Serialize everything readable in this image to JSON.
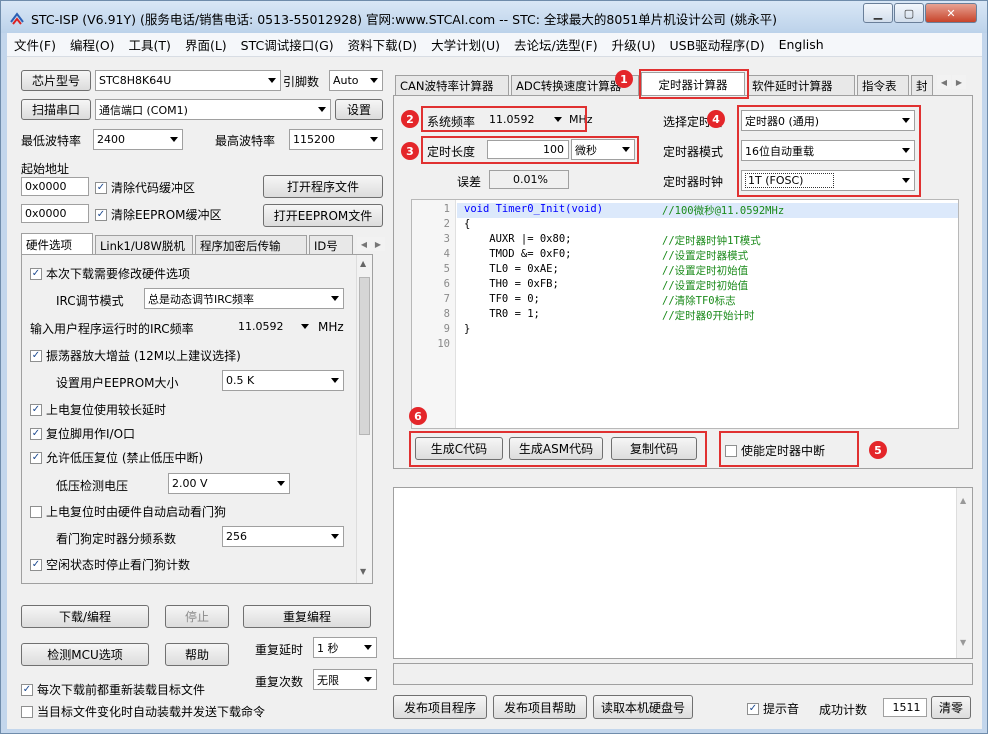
{
  "window": {
    "title": "STC-ISP (V6.91Y) (服务电话/销售电话: 0513-55012928) 官网:www.STCAI.com  -- STC: 全球最大的8051单片机设计公司 (姚永平)"
  },
  "menu": [
    "文件(F)",
    "编程(O)",
    "工具(T)",
    "界面(L)",
    "STC调试接口(G)",
    "资料下载(D)",
    "大学计划(U)",
    "去论坛/选型(F)",
    "升级(U)",
    "USB驱动程序(D)",
    "English"
  ],
  "left": {
    "chip_label": "芯片型号",
    "chip_value": "STC8H8K64U",
    "pin_label": "引脚数",
    "pin_value": "Auto",
    "scan_label": "扫描串口",
    "port_value": "通信端口 (COM1)",
    "settings_label": "设置",
    "min_baud_label": "最低波特率",
    "min_baud_value": "2400",
    "max_baud_label": "最高波特率",
    "max_baud_value": "115200",
    "start_addr_label": "起始地址",
    "addr1": "0x0000",
    "clear_code_label": "清除代码缓冲区",
    "open_prog_label": "打开程序文件",
    "addr2": "0x0000",
    "clear_eeprom_label": "清除EEPROM缓冲区",
    "open_eeprom_label": "打开EEPROM文件",
    "tabs": [
      "硬件选项",
      "Link1/U8W脱机",
      "程序加密后传输",
      "ID号"
    ],
    "options": {
      "modify_hw": "本次下载需要修改硬件选项",
      "irc_mode_label": "IRC调节模式",
      "irc_mode_value": "总是动态调节IRC频率",
      "irc_freq_label": "输入用户程序运行时的IRC频率",
      "irc_freq_value": "11.0592",
      "irc_freq_unit": "MHz",
      "osc_gain": "振荡器放大增益 (12M以上建议选择)",
      "eeprom_size_label": "设置用户EEPROM大小",
      "eeprom_size_value": "0.5 K",
      "power_delay": "上电复位使用较长延时",
      "reset_io": "复位脚用作I/O口",
      "lvr": "允许低压复位 (禁止低压中断)",
      "lv_label": "低压检测电压",
      "lv_value": "2.00 V",
      "wdt_auto": "上电复位时由硬件自动启动看门狗",
      "wdt_div_label": "看门狗定时器分频系数",
      "wdt_div_value": "256",
      "wdt_idle": "空闲状态时停止看门狗计数"
    },
    "download_label": "下载/编程",
    "stop_label": "停止",
    "reprogram_label": "重复编程",
    "detect_label": "检测MCU选项",
    "help_label": "帮助",
    "repeat_delay_label": "重复延时",
    "repeat_delay_value": "1 秒",
    "repeat_count_label": "重复次数",
    "repeat_count_value": "无限",
    "reload_before": "每次下载前都重新装载目标文件",
    "auto_reload": "当目标文件变化时自动装载并发送下载命令"
  },
  "right": {
    "tabs": [
      "CAN波特率计算器",
      "ADC转换速度计算器",
      "定时器计算器",
      "软件延时计算器",
      "指令表",
      "封"
    ],
    "sys_freq_label": "系统频率",
    "sys_freq_value": "11.0592",
    "sys_freq_unit": "MHz",
    "timer_len_label": "定时长度",
    "timer_len_value": "100",
    "timer_unit": "微秒",
    "error_label": "误差",
    "error_value": "0.01%",
    "select_timer_label": "选择定时器",
    "select_timer_value": "定时器0 (通用)",
    "timer_mode_label": "定时器模式",
    "timer_mode_value": "16位自动重载",
    "timer_clock_label": "定时器时钟",
    "timer_clock_value": "1T  (FOSC)",
    "code_lines": [
      {
        "n": "1",
        "text": "void Timer0_Init(void)",
        "comment": "//100微秒@11.0592MHz"
      },
      {
        "n": "2",
        "text": "{",
        "comment": ""
      },
      {
        "n": "3",
        "text": "    AUXR |= 0x80;",
        "comment": "//定时器时钟1T模式"
      },
      {
        "n": "4",
        "text": "    TMOD &= 0xF0;",
        "comment": "//设置定时器模式"
      },
      {
        "n": "5",
        "text": "    TL0 = 0xAE;",
        "comment": "//设置定时初始值"
      },
      {
        "n": "6",
        "text": "    TH0 = 0xFB;",
        "comment": "//设置定时初始值"
      },
      {
        "n": "7",
        "text": "    TF0 = 0;",
        "comment": "//清除TF0标志"
      },
      {
        "n": "8",
        "text": "    TR0 = 1;",
        "comment": "//定时器0开始计时"
      },
      {
        "n": "9",
        "text": "}",
        "comment": ""
      },
      {
        "n": "10",
        "text": "",
        "comment": ""
      }
    ],
    "gen_c_label": "生成C代码",
    "gen_asm_label": "生成ASM代码",
    "copy_label": "复制代码",
    "enable_int_label": "使能定时器中断",
    "publish_label": "发布项目程序",
    "publish_help_label": "发布项目帮助",
    "read_disk_label": "读取本机硬盘号",
    "beep_label": "提示音",
    "success_label": "成功计数",
    "success_value": "1511",
    "clear_label": "清零"
  },
  "badges": [
    "1",
    "2",
    "3",
    "4",
    "5",
    "6"
  ],
  "colors": {
    "annotation_red": "#e03131",
    "badge_red": "#e4262a",
    "keyword_blue": "#0000ff",
    "comment_green": "#1a8a1a"
  }
}
